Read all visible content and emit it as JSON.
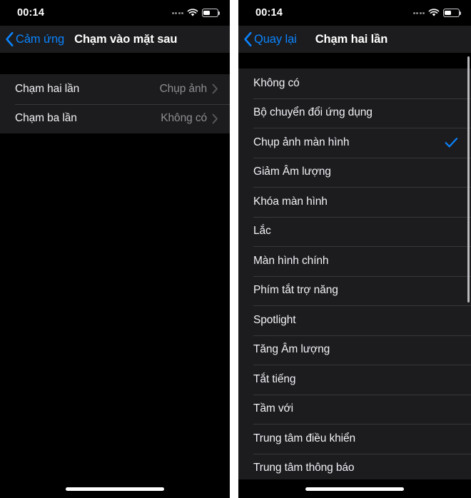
{
  "status_bar": {
    "time": "00:14",
    "signal_icon": "signal-dots-icon",
    "wifi_icon": "wifi-icon",
    "battery_icon": "battery-icon",
    "battery_percent": 45
  },
  "colors": {
    "accent_blue": "#0a84ff",
    "list_bg": "#1c1c1e",
    "page_bg": "#000000",
    "separator": "#38383a",
    "secondary_text": "#8e8e93",
    "primary_text": "#f2f2f7"
  },
  "left_panel": {
    "nav": {
      "back_label": "Cảm ứng",
      "back_icon": "chevron-left-icon",
      "title": "Chạm vào mặt sau"
    },
    "rows": [
      {
        "label": "Chạm hai lần",
        "value": "Chụp ảnh",
        "accessory": "chevron-right-icon"
      },
      {
        "label": "Chạm ba lần",
        "value": "Không có",
        "accessory": "chevron-right-icon"
      }
    ]
  },
  "right_panel": {
    "nav": {
      "back_label": "Quay lại",
      "back_icon": "chevron-left-icon",
      "title": "Chạm hai lần"
    },
    "rows": [
      {
        "label": "Không có",
        "selected": false
      },
      {
        "label": "Bộ chuyển đổi ứng dụng",
        "selected": false
      },
      {
        "label": "Chụp ảnh màn hình",
        "selected": true
      },
      {
        "label": "Giảm Âm lượng",
        "selected": false
      },
      {
        "label": "Khóa màn hình",
        "selected": false
      },
      {
        "label": "Lắc",
        "selected": false
      },
      {
        "label": "Màn hình chính",
        "selected": false
      },
      {
        "label": "Phím tắt trợ năng",
        "selected": false
      },
      {
        "label": "Spotlight",
        "selected": false
      },
      {
        "label": "Tăng Âm lượng",
        "selected": false
      },
      {
        "label": "Tắt tiếng",
        "selected": false
      },
      {
        "label": "Tầm với",
        "selected": false
      },
      {
        "label": "Trung tâm điều khiển",
        "selected": false
      },
      {
        "label": "Trung tâm thông báo",
        "selected": false
      }
    ],
    "scrollbar": "vertical-scrollbar"
  }
}
